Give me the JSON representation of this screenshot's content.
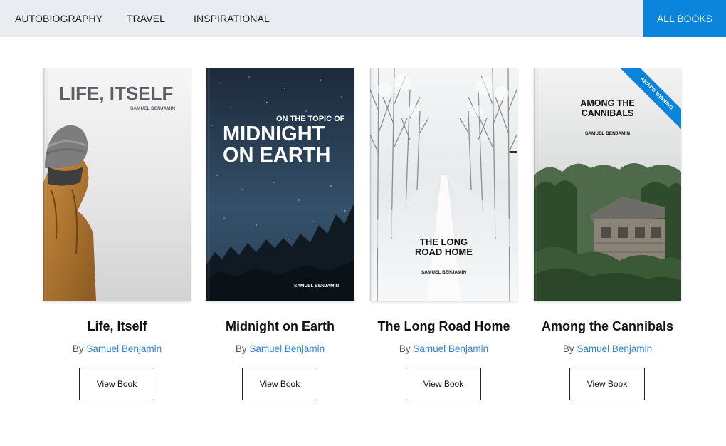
{
  "nav": {
    "categories": [
      "AUTOBIOGRAPHY",
      "TRAVEL",
      "INSPIRATIONAL"
    ],
    "all_books_label": "ALL BOOKS",
    "active_color": "#0b84db"
  },
  "books": [
    {
      "title": "Life, Itself",
      "by": "By",
      "author": "Samuel Benjamin",
      "button": "View Book",
      "cover": {
        "line1": "LIFE, ITSELF",
        "author": "SAMUEL BENJAMIN"
      }
    },
    {
      "title": "Midnight on Earth",
      "by": "By",
      "author": "Samuel Benjamin",
      "button": "View Book",
      "cover": {
        "kicker": "ON THE TOPIC OF",
        "line1": "MIDNIGHT",
        "line2": "ON EARTH",
        "author": "SAMUEL BENJAMIN"
      }
    },
    {
      "title": "The Long Road Home",
      "by": "By",
      "author": "Samuel Benjamin",
      "button": "View Book",
      "cover": {
        "line1": "THE LONG",
        "line2": "ROAD HOME",
        "author": "SAMUEL BENJAMIN"
      }
    },
    {
      "title": "Among the Cannibals",
      "by": "By",
      "author": "Samuel Benjamin",
      "button": "View Book",
      "cover": {
        "line1": "AMONG THE",
        "line2": "CANNIBALS",
        "author": "SAMUEL BENJAMIN",
        "ribbon": "AWARD WINNING"
      }
    }
  ]
}
